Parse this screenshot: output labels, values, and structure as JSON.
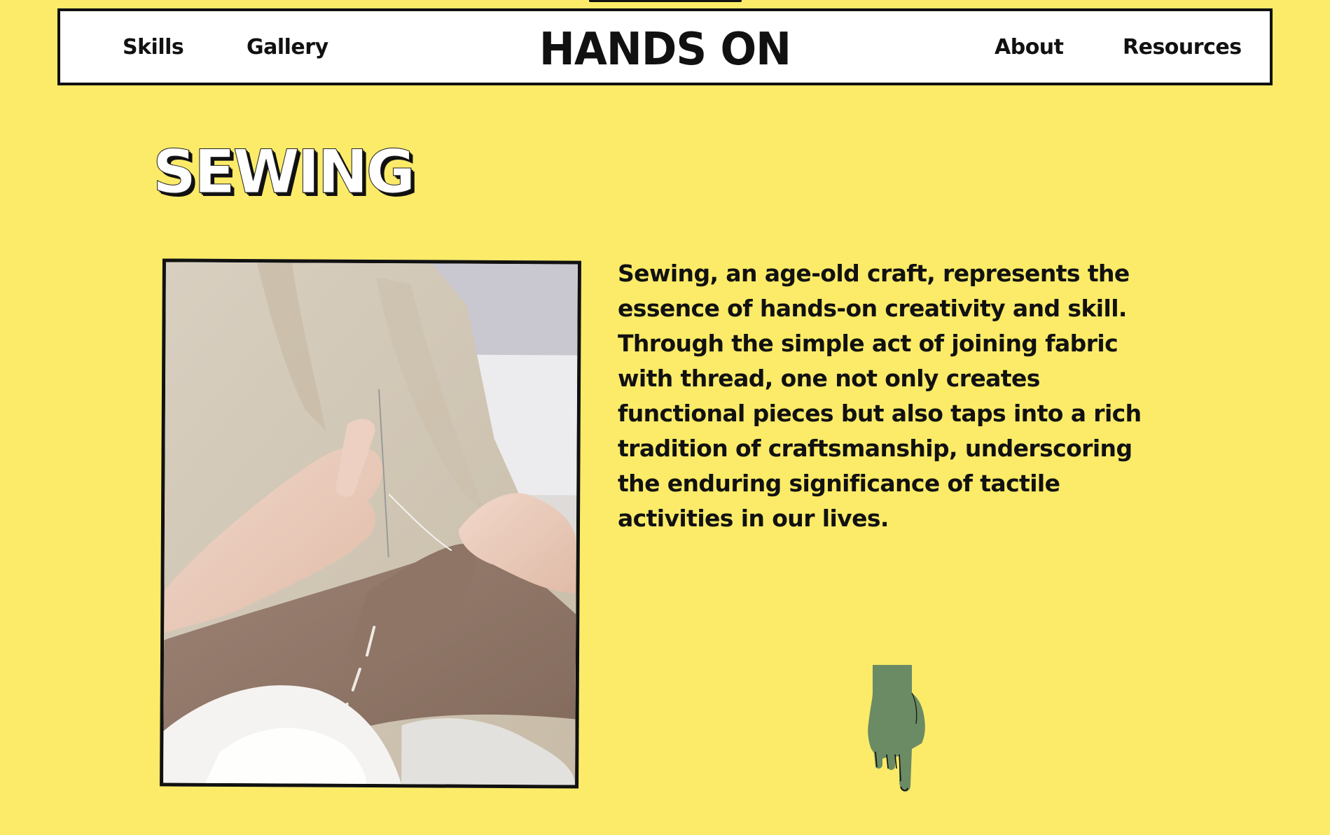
{
  "header": {
    "brand": "HANDS ON",
    "nav_left": [
      {
        "label": "Skills"
      },
      {
        "label": "Gallery"
      }
    ],
    "nav_right": [
      {
        "label": "About"
      },
      {
        "label": "Resources"
      }
    ]
  },
  "main": {
    "title": "SEWING",
    "description": "Sewing, an age-old craft, represents the essence of hands-on creativity and skill. Through the simple act of joining fabric with thread, one not only creates functional pieces but also taps into a rich tradition of craftsmanship, underscoring the enduring significance of tactile activities in our lives.",
    "image_icon": "sewing-photo",
    "pointer_icon": "pointing-hand-icon"
  },
  "colors": {
    "background": "#FBEB68",
    "ink": "#111111",
    "nav_background": "#FFFFFF",
    "hand": "#6A8B64"
  }
}
